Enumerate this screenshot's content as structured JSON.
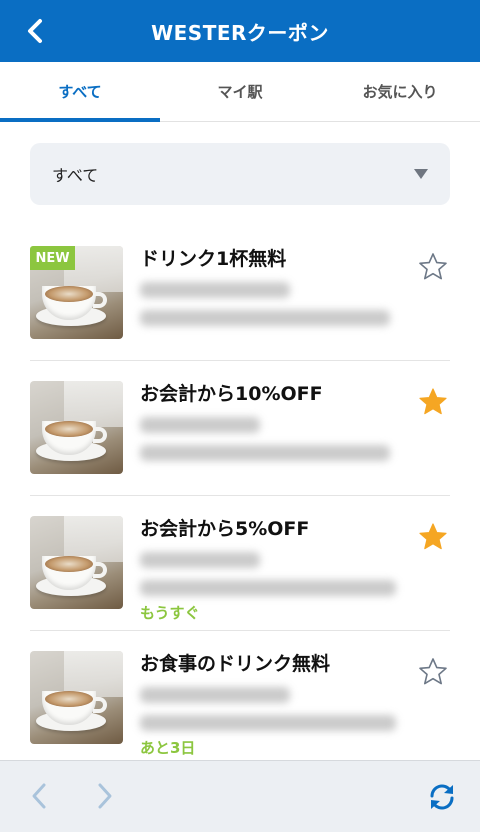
{
  "header": {
    "title": "WESTERクーポン"
  },
  "tabs": [
    {
      "label": "すべて",
      "active": true
    },
    {
      "label": "マイ駅",
      "active": false
    },
    {
      "label": "お気に入り",
      "active": false
    }
  ],
  "filter": {
    "selected": "すべて"
  },
  "coupons": [
    {
      "title": "ドリンク1杯無料",
      "badge": "NEW",
      "status": "",
      "favorite": false
    },
    {
      "title": "お会計から10%OFF",
      "badge": "",
      "status": "",
      "favorite": true
    },
    {
      "title": "お会計から5%OFF",
      "badge": "",
      "status": "もうすぐ",
      "favorite": true
    },
    {
      "title": "お食事のドリンク無料",
      "badge": "",
      "status": "あと3日",
      "favorite": false
    }
  ],
  "icons": {
    "back": "chevron-left-icon",
    "prev": "chevron-left-icon",
    "next": "chevron-right-icon",
    "refresh": "refresh-icon",
    "favorite_on": "star-filled-icon",
    "favorite_off": "star-outline-icon"
  },
  "colors": {
    "brand": "#0a6ec3",
    "badge": "#8cc63f",
    "status": "#8cc63f",
    "star_on": "#f5a623",
    "star_off": "#6d7887"
  }
}
